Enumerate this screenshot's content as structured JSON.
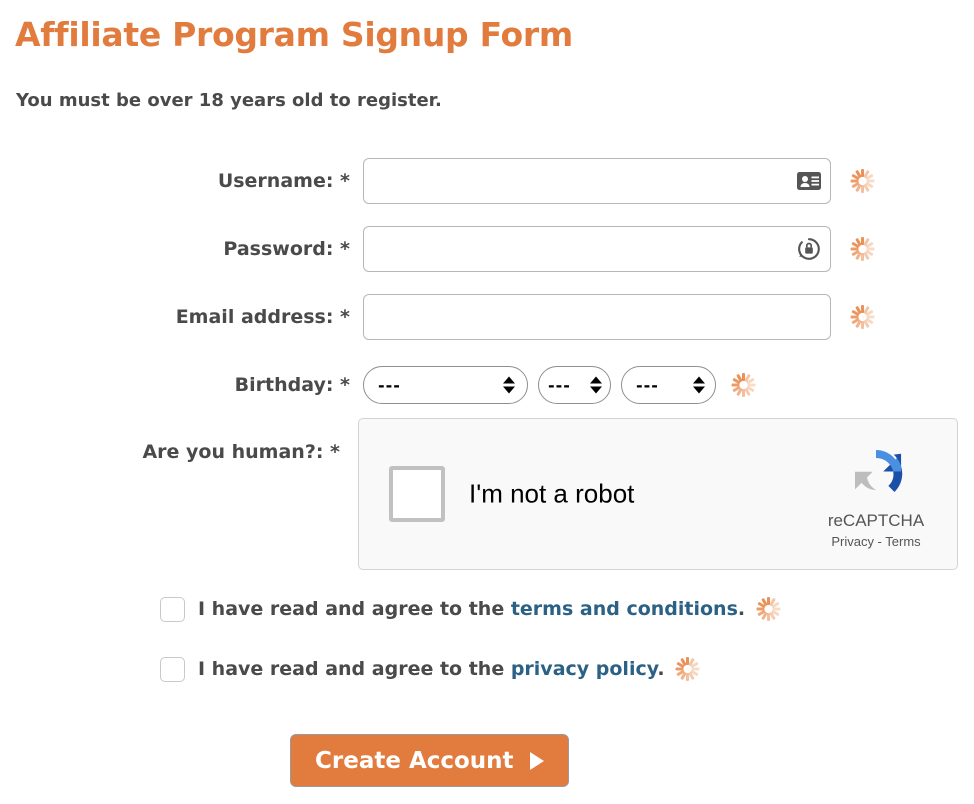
{
  "page": {
    "title": "Affiliate Program Signup Form",
    "subtitle": "You must be over 18 years old to register."
  },
  "colors": {
    "accent_orange": "#e17b3e",
    "label_grey": "#4a4a4a",
    "link_blue": "#2b6185",
    "spinner_orange": "#e98b4e",
    "recaptcha_blue_light": "#4a90e2",
    "recaptcha_blue_dark": "#1c4fa8",
    "recaptcha_grey": "#bdbdbd"
  },
  "fields": {
    "username": {
      "label": "Username: *",
      "value": "",
      "placeholder": "",
      "icon": "id-card-icon",
      "has_spinner": true
    },
    "password": {
      "label": "Password: *",
      "value": "",
      "placeholder": "",
      "icon": "lock-refresh-icon",
      "has_spinner": true
    },
    "email": {
      "label": "Email address: *",
      "value": "",
      "placeholder": "",
      "icon": "",
      "has_spinner": true
    },
    "birthday": {
      "label": "Birthday: *",
      "has_spinner": true,
      "selects": [
        {
          "name": "birthday-day-select",
          "value": "---"
        },
        {
          "name": "birthday-month-select",
          "value": "---"
        },
        {
          "name": "birthday-year-select",
          "value": "---"
        }
      ]
    },
    "human": {
      "label": "Are you human?: *"
    }
  },
  "recaptcha": {
    "checkbox_label": "I'm not a robot",
    "brand": "reCAPTCHA",
    "legal": "Privacy - Terms",
    "checked": false
  },
  "agreements": [
    {
      "name": "terms-checkbox",
      "prefix": "I have read and agree to the ",
      "link": "terms and conditions",
      "suffix": ".",
      "checked": false,
      "has_spinner": true
    },
    {
      "name": "privacy-checkbox",
      "prefix": "I have read and agree to the ",
      "link": "privacy policy",
      "suffix": ".",
      "checked": false,
      "has_spinner": true
    }
  ],
  "submit": {
    "label": "Create Account"
  }
}
